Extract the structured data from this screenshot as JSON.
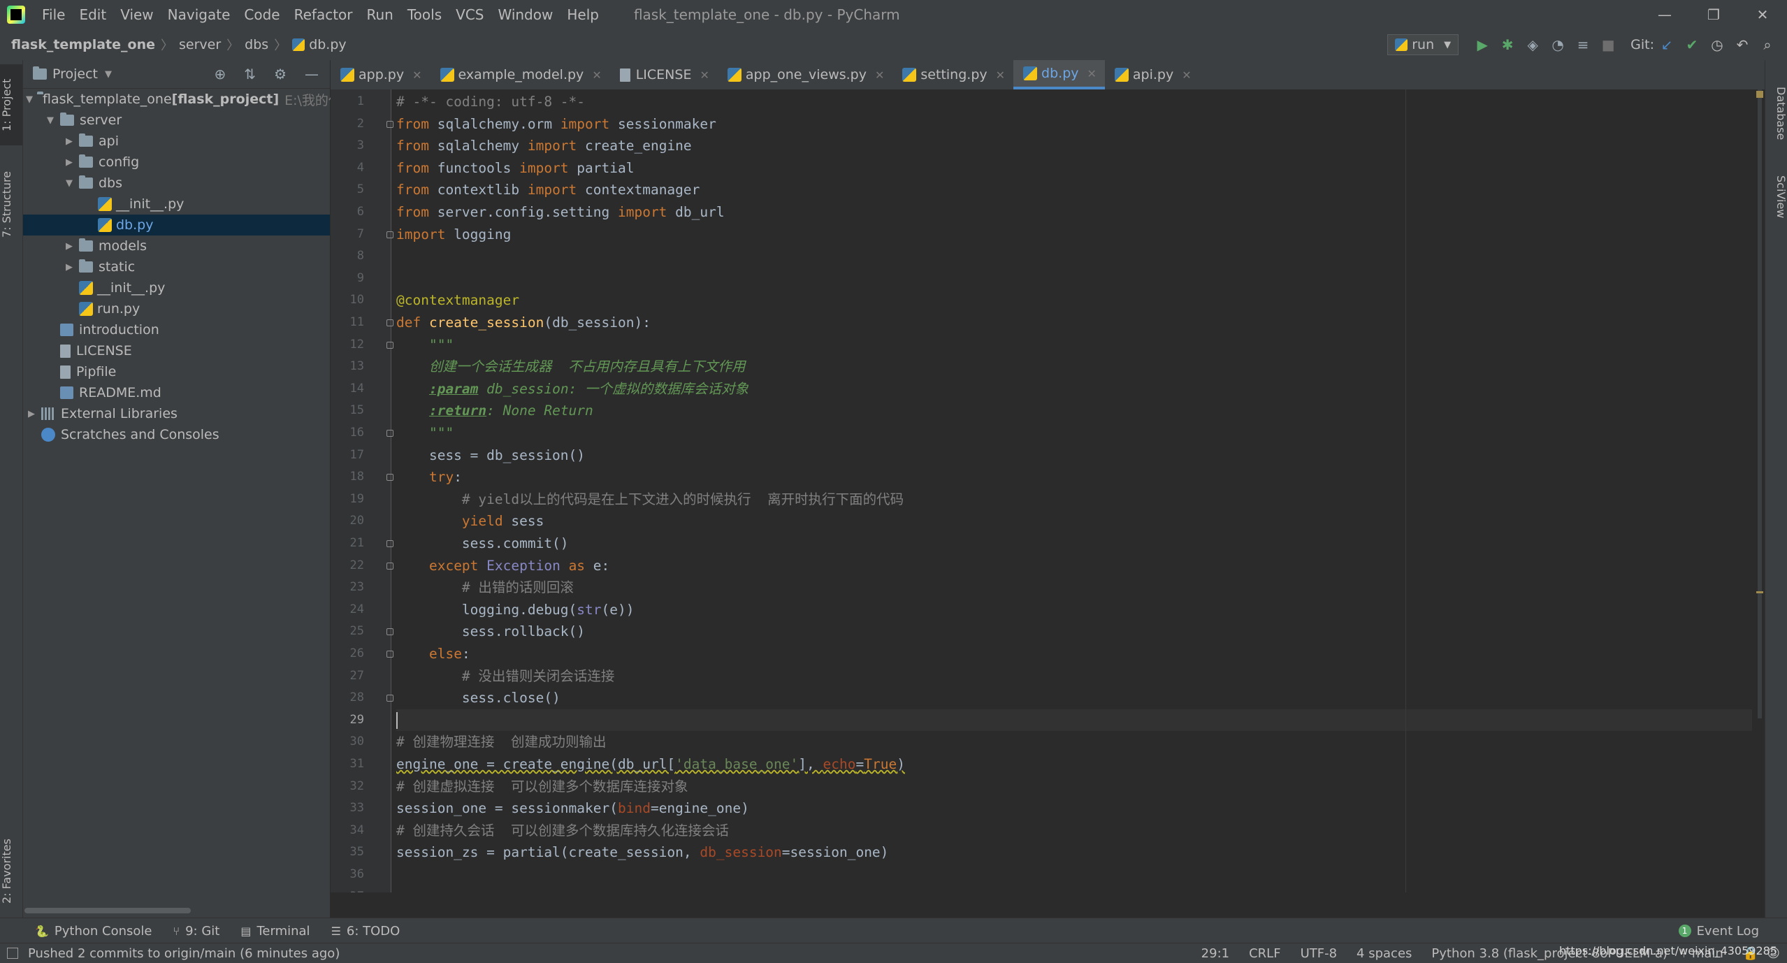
{
  "window": {
    "title": "flask_template_one - db.py - PyCharm",
    "controls": [
      "—",
      "❐",
      "✕"
    ]
  },
  "menu": [
    "File",
    "Edit",
    "View",
    "Navigate",
    "Code",
    "Refactor",
    "Run",
    "Tools",
    "VCS",
    "Window",
    "Help"
  ],
  "breadcrumb": [
    "flask_template_one",
    "server",
    "dbs",
    "db.py"
  ],
  "toolbar": {
    "run_config": "run",
    "git_label": "Git:"
  },
  "left_tools": [
    "1: Project",
    "7: Structure",
    "2: Favorites"
  ],
  "right_tools": [
    "Database",
    "SciView"
  ],
  "project": {
    "header": "Project",
    "tree": [
      {
        "label": "flask_template_one",
        "bold": " [flask_project]",
        "dim": "E:\\我的代",
        "indent": 0,
        "arrow": "▼",
        "icon": "folder"
      },
      {
        "label": "server",
        "indent": 1,
        "arrow": "▼",
        "icon": "folder"
      },
      {
        "label": "api",
        "indent": 2,
        "arrow": "▶",
        "icon": "folder"
      },
      {
        "label": "config",
        "indent": 2,
        "arrow": "▶",
        "icon": "folder"
      },
      {
        "label": "dbs",
        "indent": 2,
        "arrow": "▼",
        "icon": "folder"
      },
      {
        "label": "__init__.py",
        "indent": 3,
        "arrow": "",
        "icon": "py"
      },
      {
        "label": "db.py",
        "indent": 3,
        "arrow": "",
        "icon": "py",
        "selected": true
      },
      {
        "label": "models",
        "indent": 2,
        "arrow": "▶",
        "icon": "folder"
      },
      {
        "label": "static",
        "indent": 2,
        "arrow": "▶",
        "icon": "folder"
      },
      {
        "label": "__init__.py",
        "indent": 2,
        "arrow": "",
        "icon": "py"
      },
      {
        "label": "run.py",
        "indent": 2,
        "arrow": "",
        "icon": "py"
      },
      {
        "label": "introduction",
        "indent": 1,
        "arrow": "",
        "icon": "md"
      },
      {
        "label": "LICENSE",
        "indent": 1,
        "arrow": "",
        "icon": "file"
      },
      {
        "label": "Pipfile",
        "indent": 1,
        "arrow": "",
        "icon": "file"
      },
      {
        "label": "README.md",
        "indent": 1,
        "arrow": "",
        "icon": "md"
      },
      {
        "label": "External Libraries",
        "indent": 0,
        "arrow": "▶",
        "icon": "lib"
      },
      {
        "label": "Scratches and Consoles",
        "indent": 0,
        "arrow": "",
        "icon": "scratch"
      }
    ]
  },
  "tabs": [
    {
      "label": "app.py",
      "icon": "py"
    },
    {
      "label": "example_model.py",
      "icon": "py"
    },
    {
      "label": "LICENSE",
      "icon": "file"
    },
    {
      "label": "app_one_views.py",
      "icon": "py"
    },
    {
      "label": "setting.py",
      "icon": "py"
    },
    {
      "label": "db.py",
      "icon": "py",
      "active": true
    },
    {
      "label": "api.py",
      "icon": "py"
    }
  ],
  "editor": {
    "current_line": 29,
    "lines": [
      [
        [
          "cm",
          "# -*- coding: utf-8 -*-"
        ]
      ],
      [
        [
          "kw",
          "from "
        ],
        [
          "",
          "sqlalchemy.orm "
        ],
        [
          "kw",
          "import "
        ],
        [
          "",
          "sessionmaker"
        ]
      ],
      [
        [
          "kw",
          "from "
        ],
        [
          "",
          "sqlalchemy "
        ],
        [
          "kw",
          "import "
        ],
        [
          "",
          "create_engine"
        ]
      ],
      [
        [
          "kw",
          "from "
        ],
        [
          "",
          "functools "
        ],
        [
          "kw",
          "import "
        ],
        [
          "",
          "partial"
        ]
      ],
      [
        [
          "kw",
          "from "
        ],
        [
          "",
          "contextlib "
        ],
        [
          "kw",
          "import "
        ],
        [
          "",
          "contextmanager"
        ]
      ],
      [
        [
          "kw",
          "from "
        ],
        [
          "",
          "server.config.setting "
        ],
        [
          "kw",
          "import "
        ],
        [
          "",
          "db_url"
        ]
      ],
      [
        [
          "kw",
          "import "
        ],
        [
          "",
          "logging"
        ]
      ],
      [],
      [],
      [
        [
          "dec",
          "@contextmanager"
        ]
      ],
      [
        [
          "kw",
          "def "
        ],
        [
          "fn",
          "create_session"
        ],
        [
          "",
          "(db_session):"
        ]
      ],
      [
        [
          "dc",
          "    \"\"\""
        ]
      ],
      [
        [
          "dc",
          "    创建一个会话生成器  不占用内存且具有上下文作用"
        ]
      ],
      [
        [
          "dc",
          "    "
        ],
        [
          "dctag",
          ":param"
        ],
        [
          "dc",
          " db_session: 一个虚拟的数据库会话对象"
        ]
      ],
      [
        [
          "dc",
          "    "
        ],
        [
          "dctag",
          ":return"
        ],
        [
          "dc",
          ": None Return"
        ]
      ],
      [
        [
          "dc",
          "    \"\"\""
        ]
      ],
      [
        [
          "",
          "    sess = db_session()"
        ]
      ],
      [
        [
          "",
          "    "
        ],
        [
          "kw",
          "try"
        ],
        [
          "",
          ":"
        ]
      ],
      [
        [
          "cm",
          "        # yield以上的代码是在上下文进入的时候执行  离开时执行下面的代码"
        ]
      ],
      [
        [
          "",
          "        "
        ],
        [
          "kw",
          "yield "
        ],
        [
          "",
          "sess"
        ]
      ],
      [
        [
          "",
          "        sess.commit()"
        ]
      ],
      [
        [
          "",
          "    "
        ],
        [
          "kw",
          "except "
        ],
        [
          "bi",
          "Exception "
        ],
        [
          "kw",
          "as "
        ],
        [
          "",
          "e:"
        ]
      ],
      [
        [
          "cm",
          "        # 出错的话则回滚"
        ]
      ],
      [
        [
          "",
          "        logging.debug("
        ],
        [
          "bi",
          "str"
        ],
        [
          "",
          "(e))"
        ]
      ],
      [
        [
          "",
          "        sess.rollback()"
        ]
      ],
      [
        [
          "",
          "    "
        ],
        [
          "kw",
          "else"
        ],
        [
          "",
          ":"
        ]
      ],
      [
        [
          "cm",
          "        # 没出错则关闭会话连接"
        ]
      ],
      [
        [
          "",
          "        sess.close()"
        ]
      ],
      [
        [
          "caret",
          ""
        ]
      ],
      [
        [
          "cm",
          "# 创建物理连接  创建成功则输出"
        ]
      ],
      [
        [
          "wavy",
          "engine_one = create_engine(db_url["
        ],
        [
          "st wavy",
          "'data_base_one'"
        ],
        [
          "wavy",
          "], "
        ],
        [
          "pa wavy",
          "echo"
        ],
        [
          "wavy",
          "="
        ],
        [
          "kw wavy",
          "True"
        ],
        [
          "wavy",
          ")"
        ]
      ],
      [
        [
          "cm",
          "# 创建虚拟连接  可以创建多个数据库连接对象"
        ]
      ],
      [
        [
          "",
          "session_one = sessionmaker("
        ],
        [
          "pa",
          "bind"
        ],
        [
          "",
          "=engine_one)"
        ]
      ],
      [
        [
          "cm",
          "# 创建持久会话  可以创建多个数据库持久化连接会话"
        ]
      ],
      [
        [
          "",
          "session_zs = partial(create_session, "
        ],
        [
          "pa",
          "db_session"
        ],
        [
          "",
          "=session_one)"
        ]
      ],
      [],
      []
    ],
    "fold_lines": [
      2,
      7,
      11,
      12,
      16,
      18,
      21,
      22,
      25,
      26,
      28
    ]
  },
  "tool_windows": [
    {
      "icon": "🐍",
      "label": "Python Console"
    },
    {
      "icon": "⑂",
      "label": "9: Git"
    },
    {
      "icon": "▤",
      "label": "Terminal"
    },
    {
      "icon": "☰",
      "label": "6: TODO"
    }
  ],
  "event_log": {
    "badge": "1",
    "label": "Event Log"
  },
  "status": {
    "message": "Pushed 2 commits to origin/main (6 minutes ago)",
    "position": "29:1",
    "line_sep": "CRLF",
    "encoding": "UTF-8",
    "indent": "4 spaces",
    "interpreter": "Python 3.8 (flask_project-8oPUELM-a)",
    "branch": "main",
    "watermark": "https://blog.csdn.net/weixin_43059285"
  },
  "colors": {
    "keyword": "#cc7832",
    "function": "#ffc66d",
    "comment": "#808080",
    "docstring": "#629755",
    "string": "#6a8759",
    "decorator": "#bbb529",
    "builtin": "#8888c6",
    "param": "#aa4926",
    "accent": "#4a88c7",
    "editor_bg": "#2b2b2b",
    "panel_bg": "#3c3f41"
  }
}
